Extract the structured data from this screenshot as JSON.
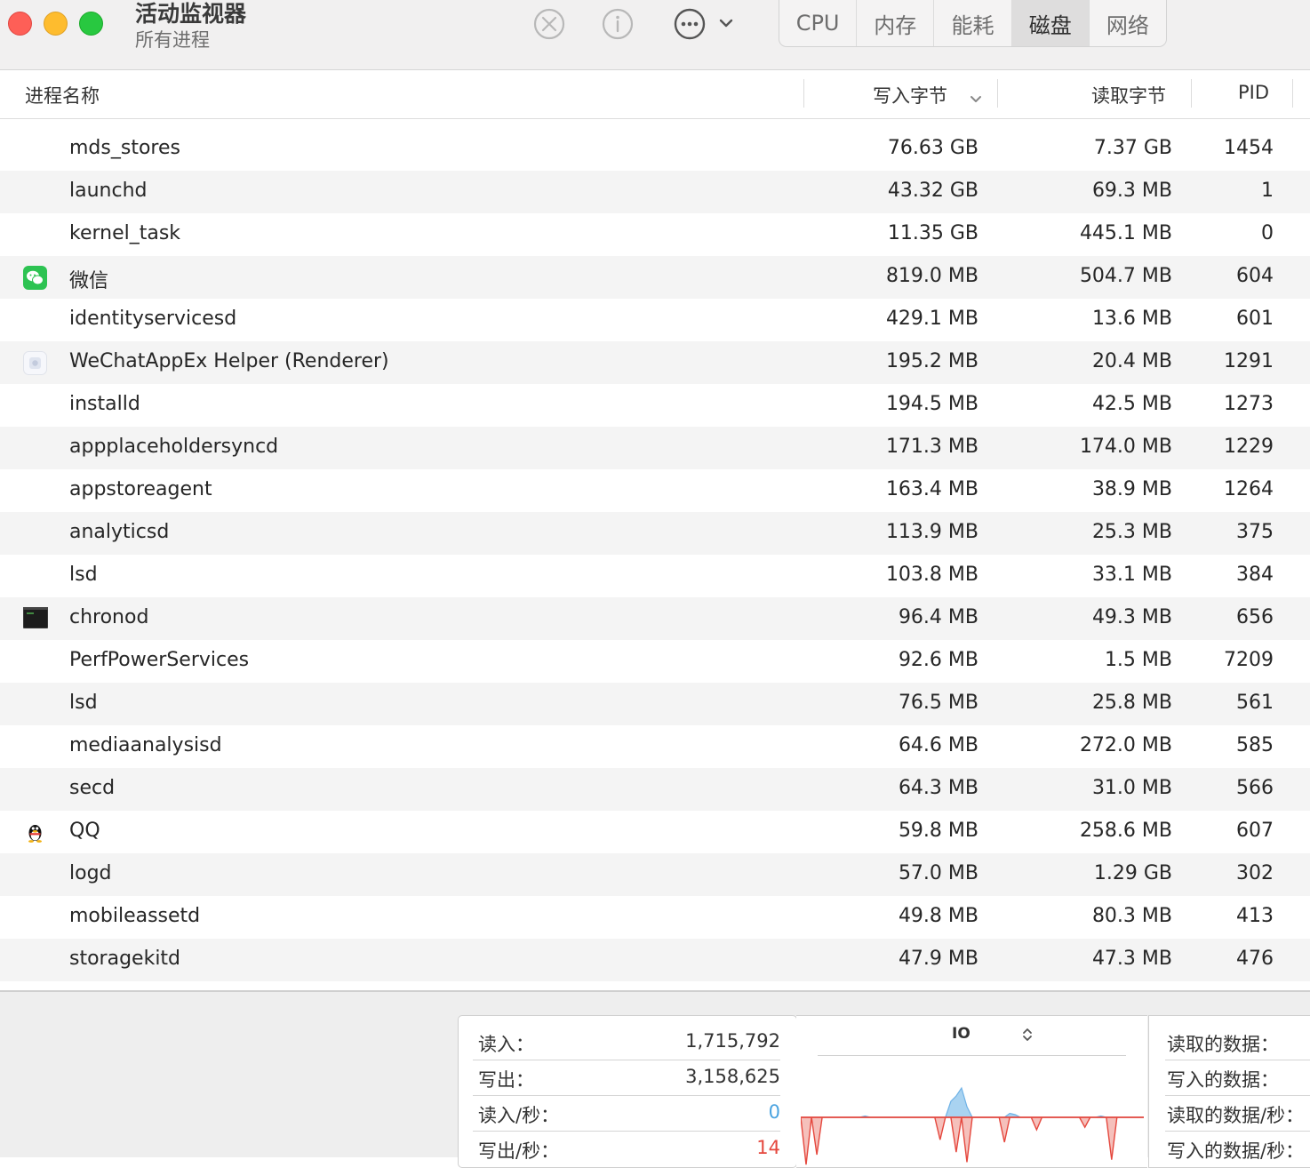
{
  "window": {
    "title": "活动监视器",
    "subtitle": "所有进程"
  },
  "toolbar": {
    "icons": [
      "stop-process-icon",
      "info-icon",
      "more-actions-icon"
    ],
    "tabs": [
      {
        "label": "CPU",
        "active": false
      },
      {
        "label": "内存",
        "active": false
      },
      {
        "label": "能耗",
        "active": false
      },
      {
        "label": "磁盘",
        "active": true
      },
      {
        "label": "网络",
        "active": false
      }
    ]
  },
  "table": {
    "columns": {
      "name": "进程名称",
      "bytes_written": "写入字节",
      "bytes_read": "读取字节",
      "pid": "PID"
    },
    "sort": {
      "column": "bytes_written",
      "direction": "descending"
    },
    "rows": [
      {
        "name": "mds_stores",
        "icon": null,
        "written": "76.63 GB",
        "read": "7.37 GB",
        "pid": "1454"
      },
      {
        "name": "launchd",
        "icon": null,
        "written": "43.32 GB",
        "read": "69.3 MB",
        "pid": "1"
      },
      {
        "name": "kernel_task",
        "icon": null,
        "written": "11.35 GB",
        "read": "445.1 MB",
        "pid": "0"
      },
      {
        "name": "微信",
        "icon": "wechat-icon",
        "written": "819.0 MB",
        "read": "504.7 MB",
        "pid": "604"
      },
      {
        "name": "identityservicesd",
        "icon": null,
        "written": "429.1 MB",
        "read": "13.6 MB",
        "pid": "601"
      },
      {
        "name": "WeChatAppEx Helper (Renderer)",
        "icon": "wechat-appex-icon",
        "written": "195.2 MB",
        "read": "20.4 MB",
        "pid": "1291"
      },
      {
        "name": "installd",
        "icon": null,
        "written": "194.5 MB",
        "read": "42.5 MB",
        "pid": "1273"
      },
      {
        "name": "appplaceholdersyncd",
        "icon": null,
        "written": "171.3 MB",
        "read": "174.0 MB",
        "pid": "1229"
      },
      {
        "name": "appstoreagent",
        "icon": null,
        "written": "163.4 MB",
        "read": "38.9 MB",
        "pid": "1264"
      },
      {
        "name": "analyticsd",
        "icon": null,
        "written": "113.9 MB",
        "read": "25.3 MB",
        "pid": "375"
      },
      {
        "name": "lsd",
        "icon": null,
        "written": "103.8 MB",
        "read": "33.1 MB",
        "pid": "384"
      },
      {
        "name": "chronod",
        "icon": "terminal-icon",
        "written": "96.4 MB",
        "read": "49.3 MB",
        "pid": "656"
      },
      {
        "name": "PerfPowerServices",
        "icon": null,
        "written": "92.6 MB",
        "read": "1.5 MB",
        "pid": "7209"
      },
      {
        "name": "lsd",
        "icon": null,
        "written": "76.5 MB",
        "read": "25.8 MB",
        "pid": "561"
      },
      {
        "name": "mediaanalysisd",
        "icon": null,
        "written": "64.6 MB",
        "read": "272.0 MB",
        "pid": "585"
      },
      {
        "name": "secd",
        "icon": null,
        "written": "64.3 MB",
        "read": "31.0 MB",
        "pid": "566"
      },
      {
        "name": "QQ",
        "icon": "qq-penguin-icon",
        "written": "59.8 MB",
        "read": "258.6 MB",
        "pid": "607"
      },
      {
        "name": "logd",
        "icon": null,
        "written": "57.0 MB",
        "read": "1.29 GB",
        "pid": "302"
      },
      {
        "name": "mobileassetd",
        "icon": null,
        "written": "49.8 MB",
        "read": "80.3 MB",
        "pid": "413"
      },
      {
        "name": "storagekitd",
        "icon": null,
        "written": "47.9 MB",
        "read": "47.3 MB",
        "pid": "476"
      }
    ]
  },
  "summary": {
    "io_stats": [
      {
        "label": "读入：",
        "value": "1,715,792",
        "color": "#333333"
      },
      {
        "label": "写出：",
        "value": "3,158,625",
        "color": "#333333"
      },
      {
        "label": "读入/秒：",
        "value": "0",
        "color": "#4aa3e0"
      },
      {
        "label": "写出/秒：",
        "value": "14",
        "color": "#e5483e"
      }
    ],
    "graph": {
      "selector": "IO",
      "read_color": "#8cc4ec",
      "write_color": "#e5483e",
      "read_series": [
        0,
        0,
        0,
        0,
        0,
        0,
        0,
        0,
        0,
        0,
        0,
        0,
        1,
        0,
        0,
        0,
        0,
        0,
        0,
        0,
        0,
        0,
        0,
        0,
        0,
        0,
        0,
        0,
        12,
        16,
        22,
        8,
        0,
        0,
        0,
        0,
        0,
        0,
        0,
        3,
        2,
        0,
        0,
        0,
        0,
        0,
        0,
        0,
        0,
        0,
        0,
        0,
        0,
        0,
        0,
        0,
        1,
        0,
        0,
        0,
        0,
        0,
        0,
        0,
        0
      ],
      "write_series": [
        0,
        38,
        0,
        30,
        0,
        0,
        0,
        0,
        0,
        0,
        0,
        0,
        0,
        0,
        0,
        0,
        0,
        0,
        0,
        0,
        0,
        0,
        0,
        0,
        0,
        0,
        18,
        0,
        0,
        28,
        0,
        36,
        0,
        0,
        0,
        0,
        0,
        0,
        20,
        0,
        0,
        0,
        0,
        0,
        10,
        0,
        0,
        0,
        0,
        0,
        0,
        0,
        0,
        8,
        0,
        0,
        0,
        0,
        34,
        0,
        0,
        0,
        0,
        0,
        0
      ]
    },
    "data_labels": [
      "读取的数据：",
      "写入的数据：",
      "读取的数据/秒：",
      "写入的数据/秒："
    ]
  }
}
